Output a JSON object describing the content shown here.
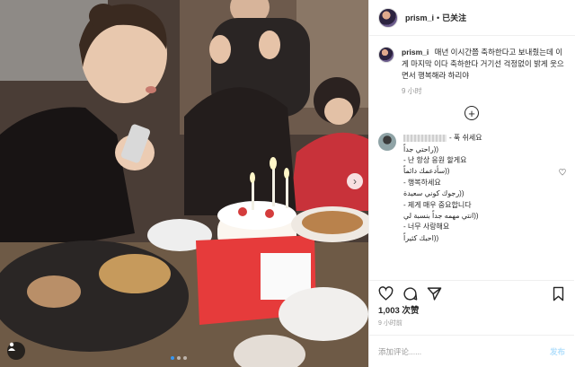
{
  "header": {
    "username": "prism_i",
    "separator": "•",
    "follow_label": "已关注"
  },
  "caption": {
    "username": "prism_i",
    "text": "매년 이시간쯤 축하한다고 보내줬는데 이게 마지막 이다 축하한다 거기선 걱정없이 밝게 웃으면서 행복해라 하리야",
    "time": "9 小时"
  },
  "load_more_label": "+",
  "comment": {
    "lines": [
      "- 푹 쉬세요",
      "((راحتي جداً",
      "- 난 항상 응원 할게요",
      "((سأدعمك دائماً",
      "- 행복하세요",
      "((رجوك كوني سعيدة",
      "- 제게 매우 중요합니다",
      "((انتي مهمه جداً بنسبة لي",
      "- 너무 사랑해요",
      "((احبك كثيراً"
    ]
  },
  "likes_text": "1,003 次赞",
  "post_time": "9 小时前",
  "add_comment": {
    "placeholder": "添加评论......",
    "post_label": "发布"
  },
  "colors": {
    "follow_link": "#262626",
    "post_button": "#b2dffc",
    "active_dot": "#3897f0"
  },
  "icons": {
    "like": "heart-icon",
    "comment": "comment-icon",
    "share": "share-icon",
    "save": "bookmark-icon",
    "tag": "user-tag-icon",
    "next": "chevron-right-icon"
  }
}
